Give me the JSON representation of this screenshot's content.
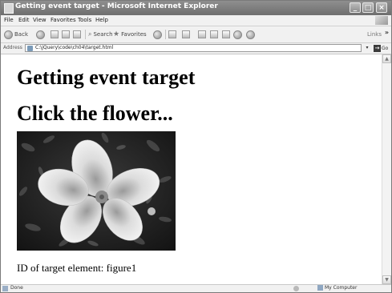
{
  "window": {
    "title": "Getting event target - Microsoft Internet Explorer",
    "minimize_glyph": "_",
    "maximize_glyph": "□",
    "close_glyph": "×"
  },
  "menu": [
    "File",
    "Edit",
    "View",
    "Favorites",
    "Tools",
    "Help"
  ],
  "toolbar": {
    "back_label": "Back",
    "search_label": "Search",
    "favorites_label": "Favorites",
    "links_label": "Links",
    "more_glyph": "»"
  },
  "address": {
    "label": "Address",
    "url": "C:\\jQuery\\code\\ch04\\target.html",
    "dropdown_glyph": "▾",
    "go_label": "Go",
    "go_glyph": "→"
  },
  "page": {
    "heading1": "Getting event target",
    "heading2": "Click the flower...",
    "figure_alt": "figure1",
    "result_text": "ID of target element: figure1"
  },
  "scrollbar": {
    "up_glyph": "▲",
    "down_glyph": "▼"
  },
  "status": {
    "text": "Done",
    "zone": "My Computer"
  }
}
